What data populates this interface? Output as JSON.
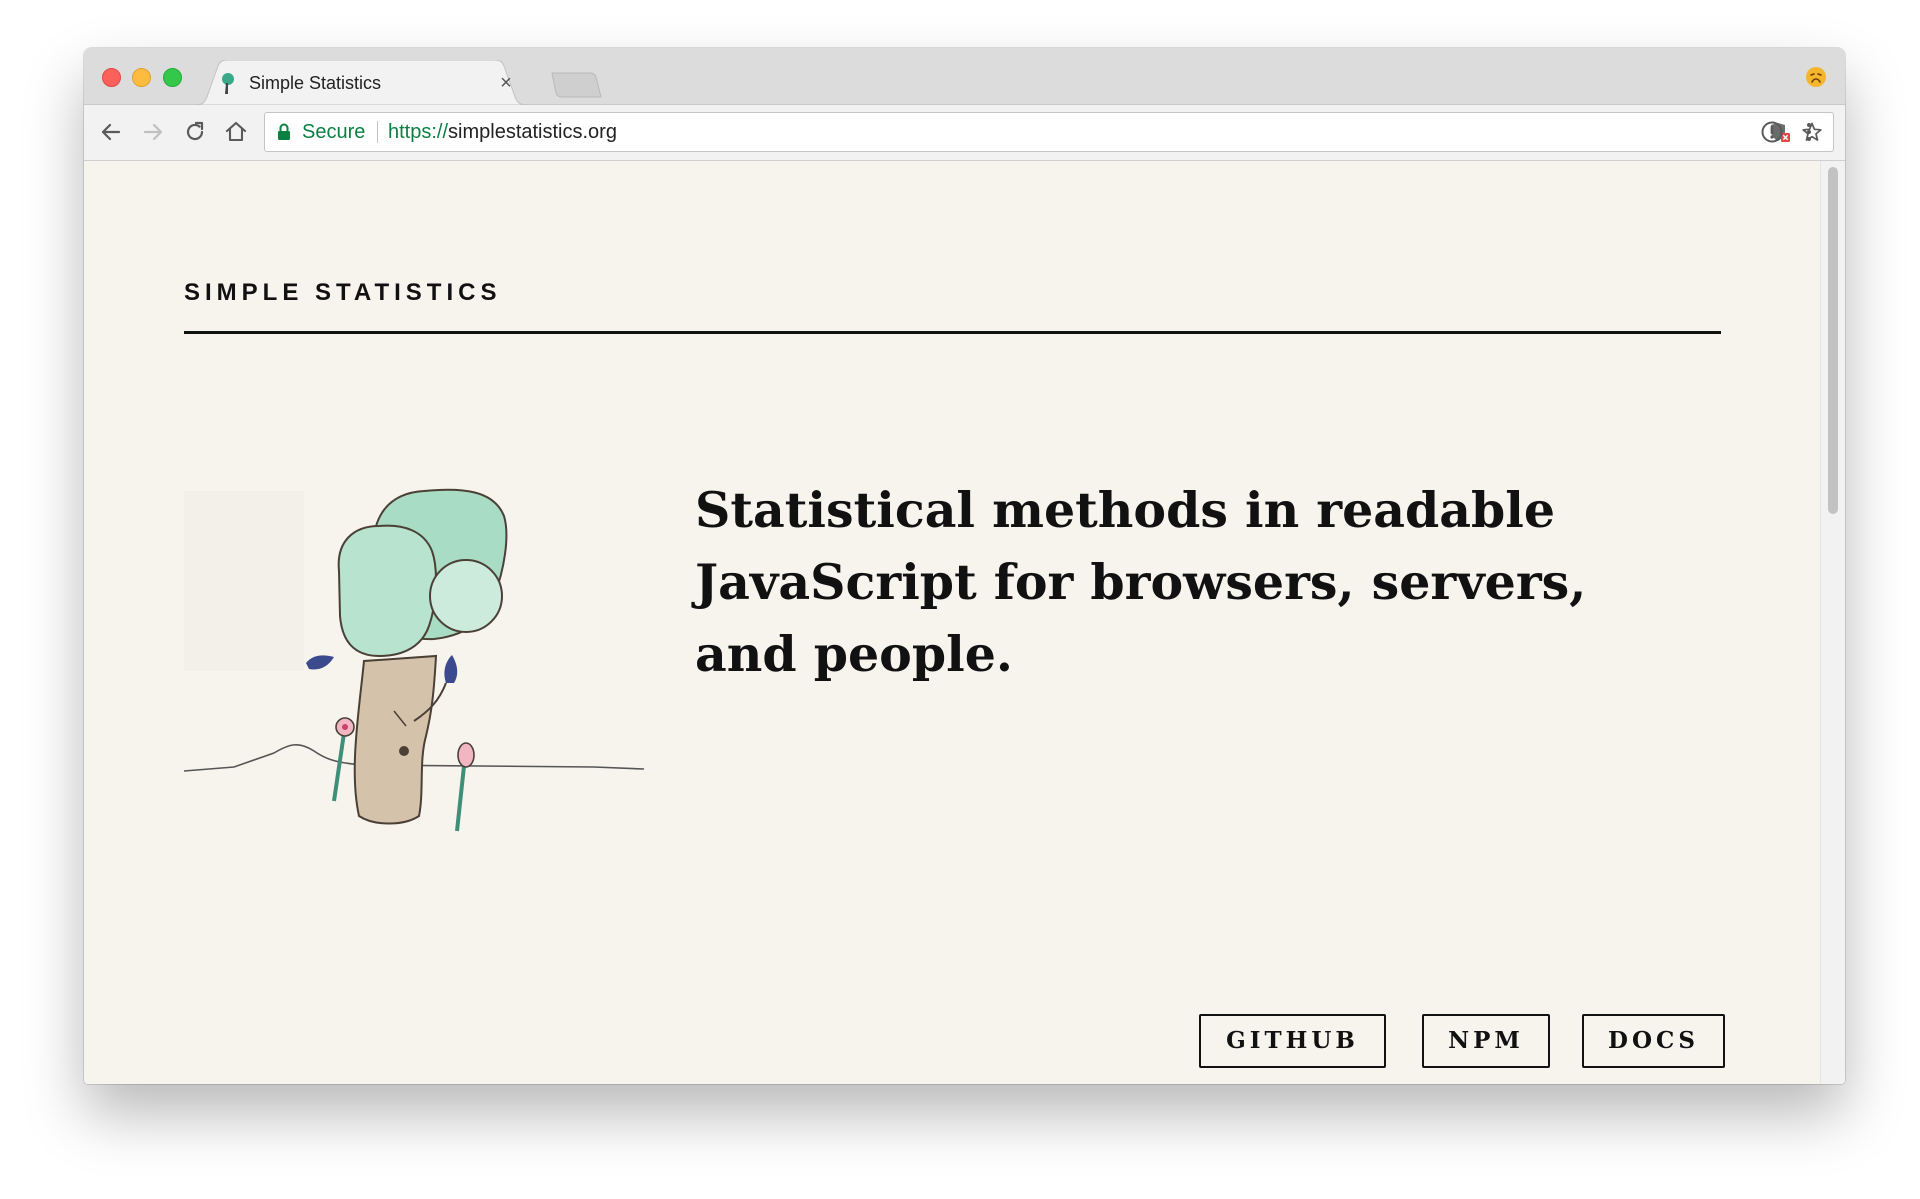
{
  "browser": {
    "tab": {
      "title": "Simple Statistics",
      "close_glyph": "×"
    },
    "omnibox": {
      "secure_label": "Secure",
      "url_scheme": "https://",
      "url_host": "simplestatistics.org"
    },
    "icons": {
      "back": "back-arrow-icon",
      "forward": "forward-arrow-icon",
      "reload": "reload-icon",
      "home": "home-icon",
      "lock": "lock-icon",
      "site_settings": "shield-blocked-icon",
      "bookmark": "star-icon",
      "extension": "password-manager-icon",
      "menu": "kebab-menu-icon",
      "profile": "profile-emoji-icon"
    },
    "colors": {
      "secure_green": "#0b8043",
      "page_background": "#f7f4ee"
    }
  },
  "page": {
    "site_title": "SIMPLE STATISTICS",
    "headline": "Statistical methods in readable JavaScript for browsers, servers, and people.",
    "buttons": {
      "github": "GITHUB",
      "npm": "NPM",
      "docs": "DOCS"
    },
    "illustration": "tree-illustration"
  }
}
